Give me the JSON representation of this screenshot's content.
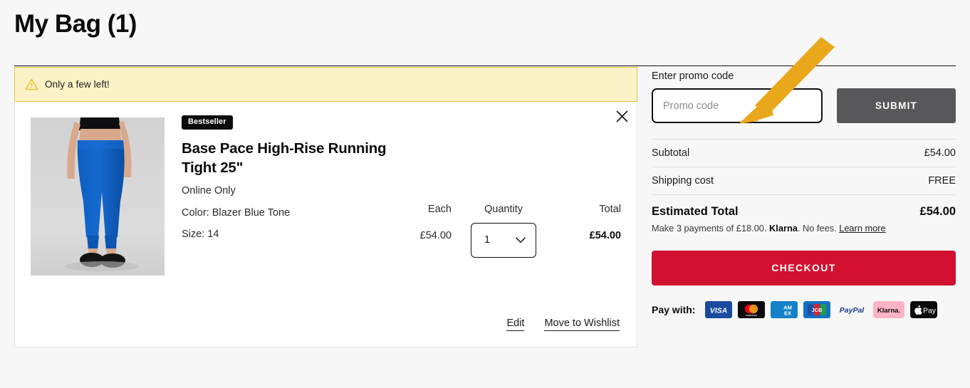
{
  "page": {
    "title": "My Bag (1)"
  },
  "alert": {
    "icon": "warning-triangle-icon",
    "text": "Only a few left!"
  },
  "product": {
    "badge": "Bestseller",
    "name": "Base Pace High-Rise Running Tight 25\"",
    "availability": "Online Only",
    "color": "Color: Blazer Blue Tone",
    "size": "Size: 14",
    "each_label": "Each",
    "each_price": "£54.00",
    "quantity_label": "Quantity",
    "quantity_value": "1",
    "total_label": "Total",
    "total_price": "£54.00",
    "remove_icon": "close-icon",
    "edit_link": "Edit",
    "wishlist_link": "Move to Wishlist",
    "image_alt": "blue high-rise running tights worn by model"
  },
  "summary": {
    "promo_label": "Enter promo code",
    "promo_placeholder": "Promo code",
    "promo_value": "",
    "submit_label": "SUBMIT",
    "rows": [
      {
        "label": "Subtotal",
        "value": "£54.00"
      },
      {
        "label": "Shipping cost",
        "value": "FREE"
      }
    ],
    "total_label": "Estimated Total",
    "total_value": "£54.00",
    "klarna_prefix": "Make 3 payments of £18.00. ",
    "klarna_brand": "Klarna",
    "klarna_suffix": ". No fees. ",
    "klarna_link": "Learn more",
    "checkout_label": "CHECKOUT",
    "pay_with_label": "Pay with:",
    "payment_methods": [
      {
        "name": "visa-icon",
        "label": "VISA"
      },
      {
        "name": "mastercard-icon",
        "label": "mastercard"
      },
      {
        "name": "amex-icon",
        "label": "AMEX"
      },
      {
        "name": "jcb-icon",
        "label": "JCB"
      },
      {
        "name": "paypal-icon",
        "label": "PayPal"
      },
      {
        "name": "klarna-icon",
        "label": "Klarna."
      },
      {
        "name": "apple-pay-icon",
        "label": "Pay"
      }
    ]
  },
  "annotation": {
    "arrow_color": "#E9A81C",
    "points_to": "promo-code-input"
  },
  "colors": {
    "page_background": "#f7f7f7",
    "alert_background": "#fcf2c7",
    "alert_border": "#e3c33c",
    "checkout_red": "#d1112f",
    "submit_gray": "#58585a",
    "badge_black": "#0b0b0b"
  }
}
